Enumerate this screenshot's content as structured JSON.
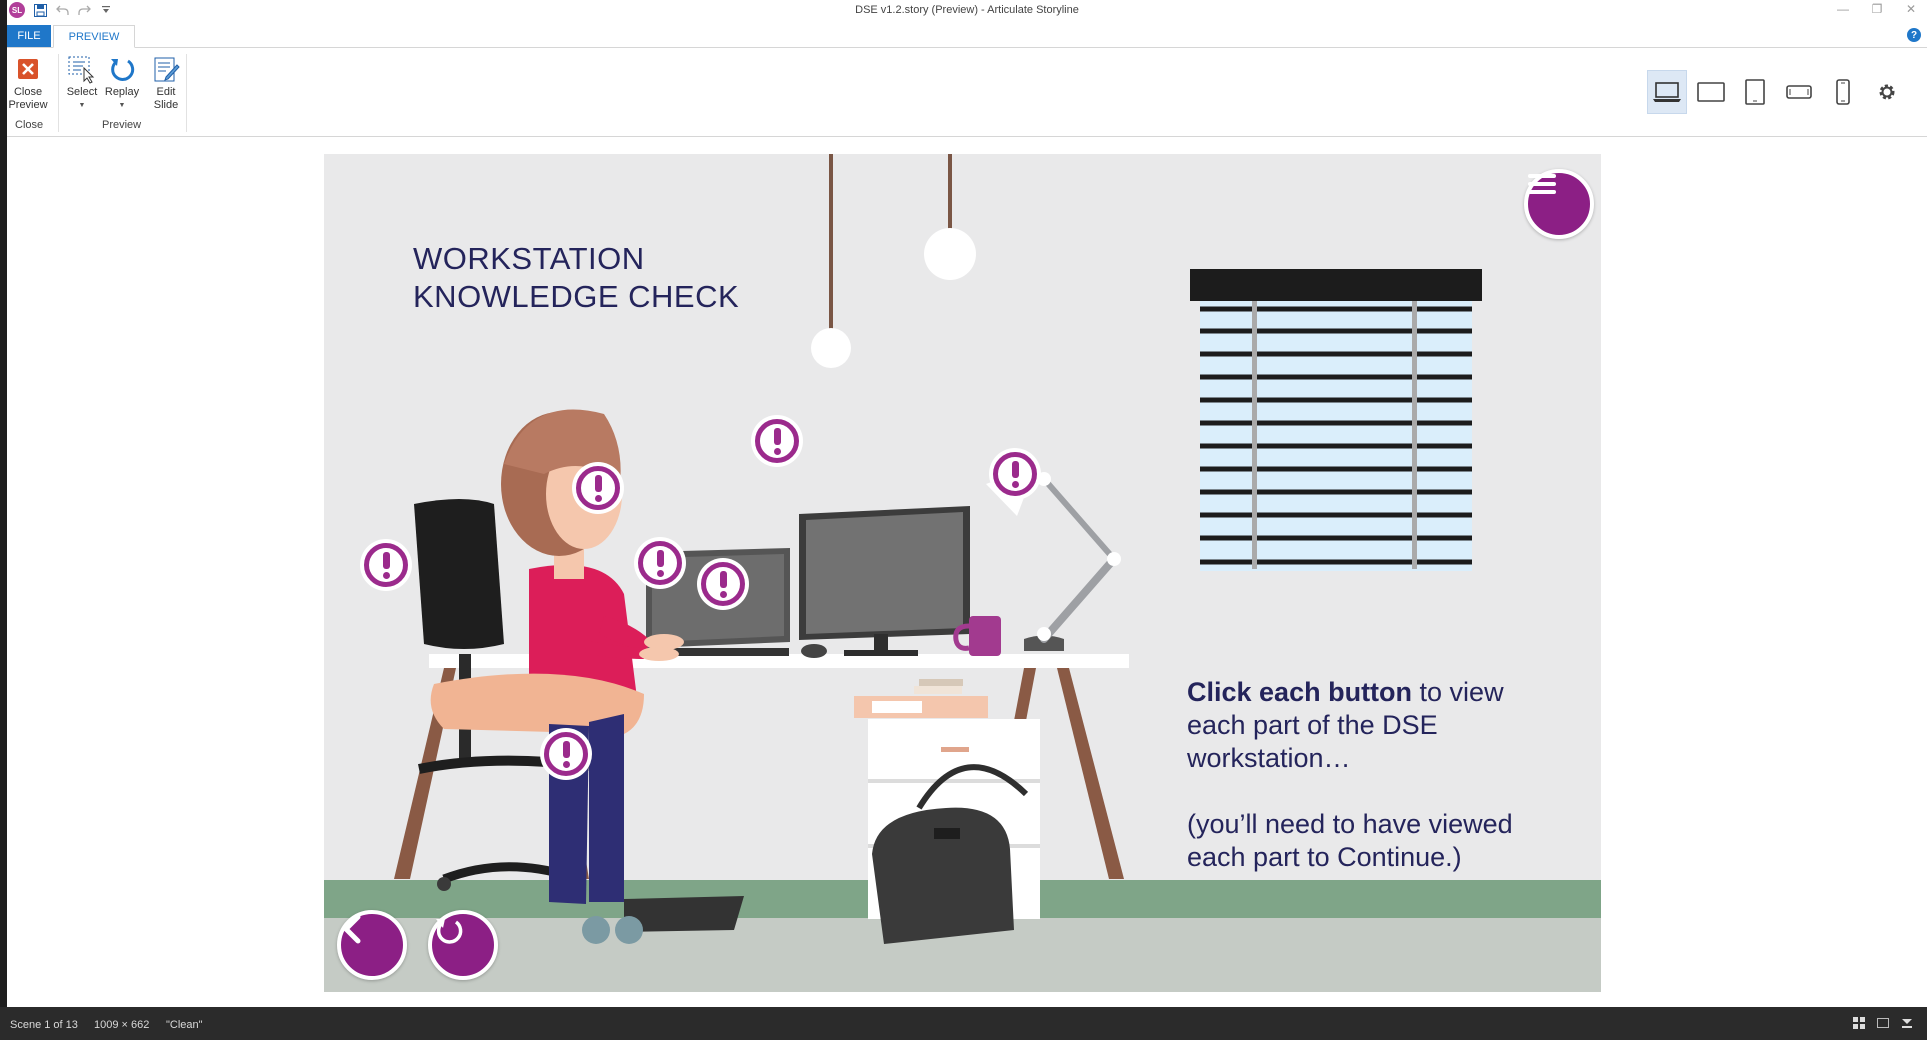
{
  "window": {
    "title": "DSE v1.2.story (Preview) -  Articulate Storyline",
    "app_logo_text": "SL"
  },
  "ribbon": {
    "tabs": [
      {
        "label": "FILE"
      },
      {
        "label": "PREVIEW"
      }
    ],
    "close_preview_label": "Close\nPreview",
    "close_group_label": "Close",
    "select_label": "Select",
    "replay_label": "Replay",
    "edit_slide_label": "Edit\nSlide",
    "preview_group_label": "Preview",
    "devices": [
      "laptop-icon",
      "tablet-landscape-icon",
      "tablet-portrait-icon",
      "phone-landscape-icon",
      "phone-portrait-icon"
    ],
    "selected_device": "laptop-icon"
  },
  "slide": {
    "title": "WORKSTATION\nKNOWLEDGE CHECK",
    "instruction_bold": "Click each button",
    "instruction_rest": " to view each part of the DSE workstation…",
    "instruction_note": "(you’ll need to have viewed each part to Continue.)",
    "hotspot_count": 8,
    "accent_color": "#8c1f85"
  },
  "statusbar": {
    "scene": "Scene 1 of 13",
    "dimensions": "1009 × 662",
    "theme": "\"Clean\""
  }
}
